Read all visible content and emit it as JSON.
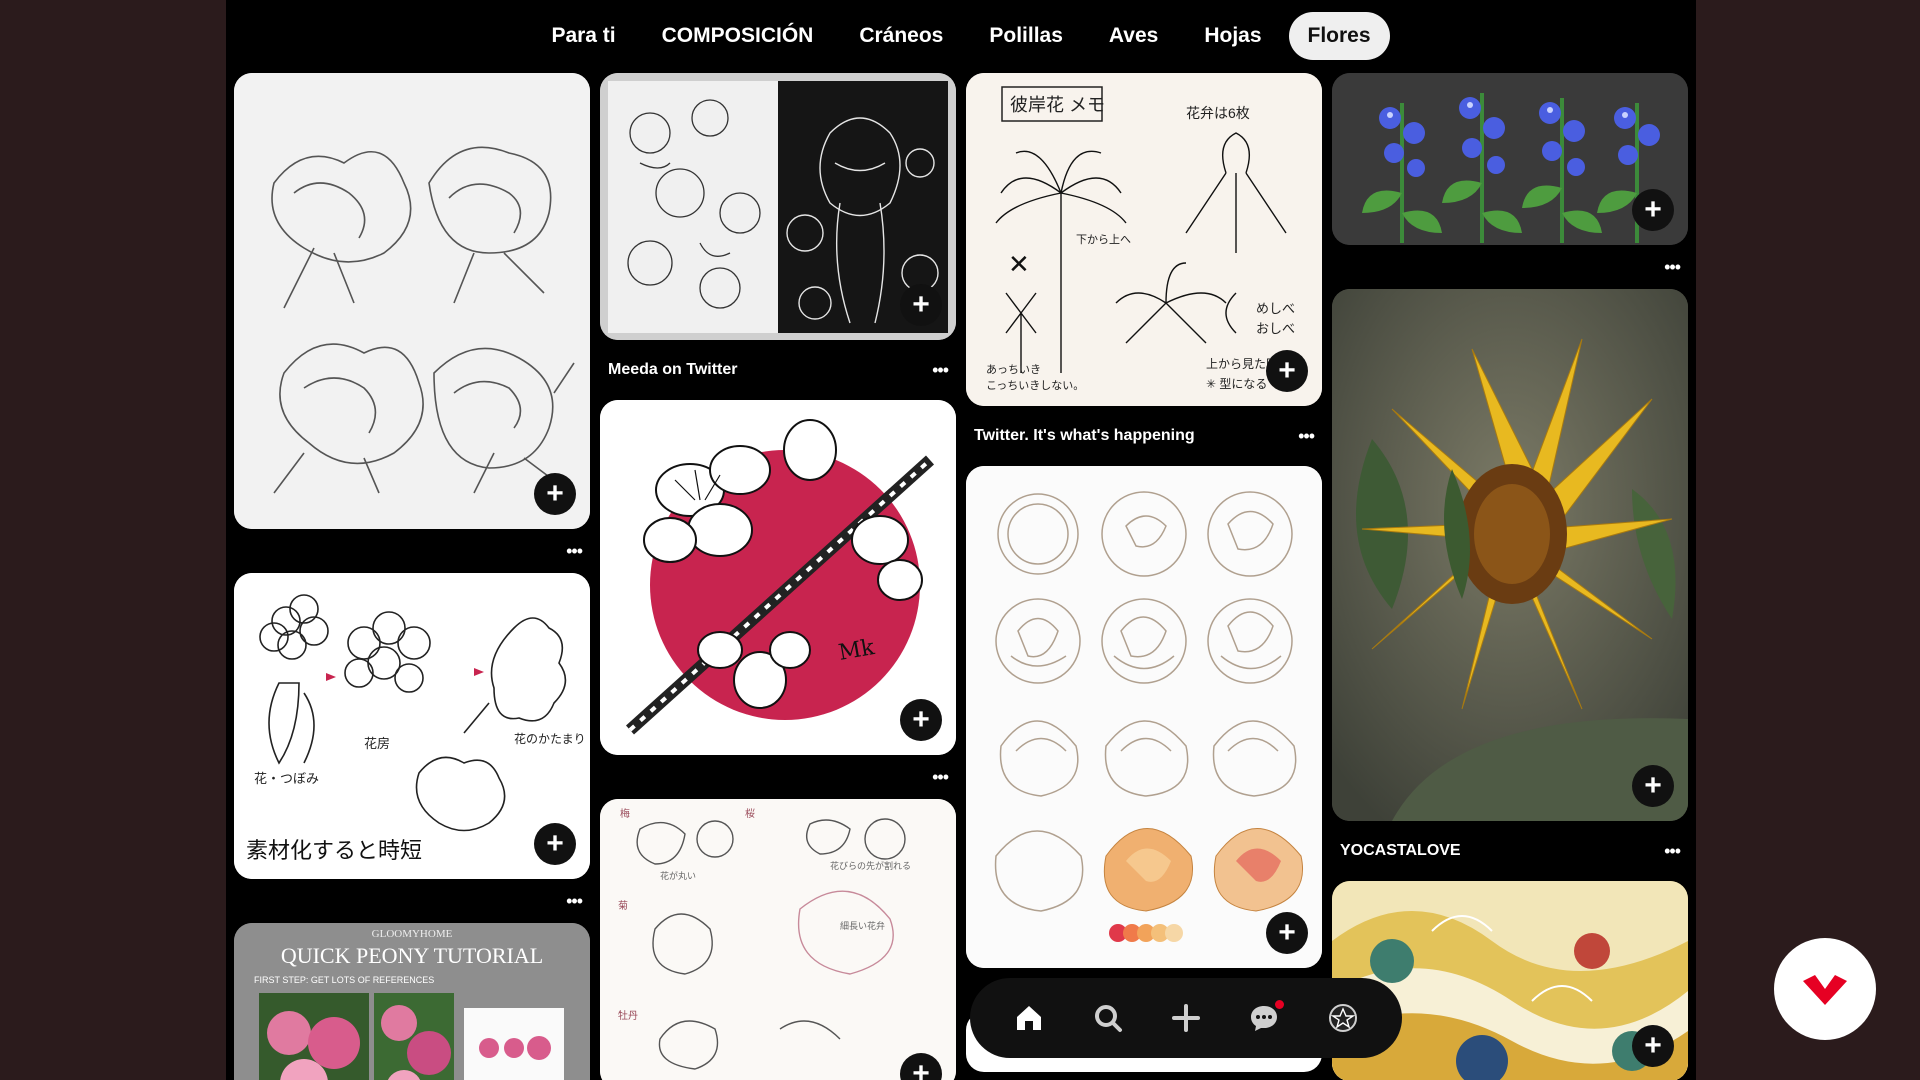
{
  "tabs": [
    {
      "label": "Para ti",
      "active": false
    },
    {
      "label": "COMPOSICIÓN",
      "active": false
    },
    {
      "label": "Cráneos",
      "active": false
    },
    {
      "label": "Polillas",
      "active": false
    },
    {
      "label": "Aves",
      "active": false
    },
    {
      "label": "Hojas",
      "active": false
    },
    {
      "label": "Flores",
      "active": true
    }
  ],
  "pins": {
    "peony_sketches": {
      "title": "",
      "image": "pencil peony sketches"
    },
    "meeda": {
      "title": "Meeda on Twitter",
      "image": "ink girl with flowers sketchbook"
    },
    "spider_lily": {
      "title": "Twitter. It's what's happening",
      "image": "spider lily notes",
      "jp_heading": "彼岸花 メモ",
      "jp_note": "花弁は6枚"
    },
    "bellflowers": {
      "title": "",
      "image": "blue bellflowers"
    },
    "blossom_steps": {
      "title": "",
      "image": "flower cluster tutorial",
      "jp_caption": "素材化すると時短"
    },
    "cherry_circle": {
      "title": "",
      "image": "cherry blossom red circle"
    },
    "rose_steps": {
      "title": "",
      "image": "rose drawing grid"
    },
    "sunflower": {
      "title": "YOCASTALOVE",
      "image": "sunflower painting"
    },
    "peony_tutorial": {
      "title": "",
      "image": "peony tutorial",
      "brand": "GLOOMYHOME",
      "heading": "QUICK PEONY TUTORIAL",
      "step": "FIRST STEP: GET LOTS OF REFERENCES"
    },
    "flower_notes": {
      "title": "",
      "image": "plum chrysanthemum notes"
    },
    "gold_pattern": {
      "title": "",
      "image": "golden japanese pattern"
    }
  },
  "save_label": "+",
  "more_label": "•••",
  "nav": [
    {
      "icon": "home-icon"
    },
    {
      "icon": "search-icon"
    },
    {
      "icon": "create-icon"
    },
    {
      "icon": "messages-icon",
      "badge": true
    },
    {
      "icon": "profile-icon"
    }
  ],
  "colors": {
    "accent": "#e60023",
    "background": "#000000",
    "outer": "#2b1b1c",
    "tab_active_bg": "#efefef",
    "cherry_red": "#c8244f"
  }
}
